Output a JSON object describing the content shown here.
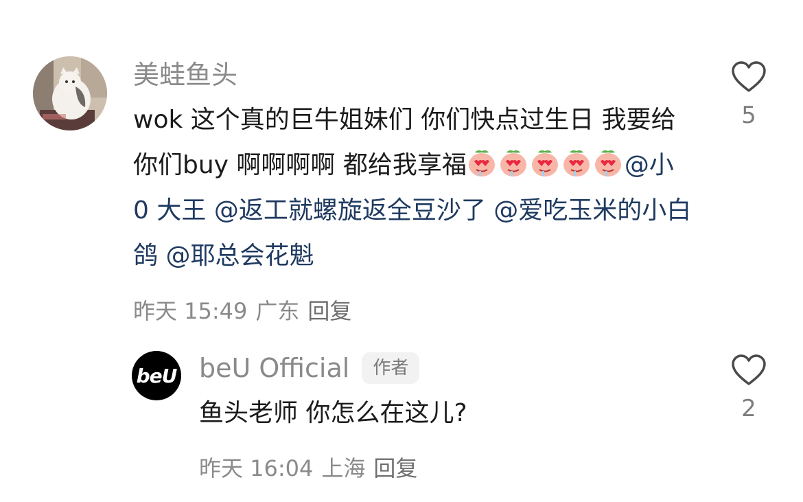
{
  "comments": [
    {
      "username": "美蛙鱼头",
      "text_parts": {
        "p1": "wok 这个真的巨牛姐妹们 你们快点过生日 我要给你们buy 啊啊啊啊 都给我享福",
        "mention1": "@小 0 大王",
        "mention2": "@返工就螺旋返全豆沙了",
        "mention3": "@爱吃玉米的小白鸽",
        "mention4": "@耶总会花魁"
      },
      "emoji_name": "heart-eyes-peach-emoji",
      "emoji_count": 5,
      "date": "昨天 15:49",
      "location": "广东",
      "reply_label": "回复",
      "like_count": "5"
    },
    {
      "username": "beU Official",
      "avatar_text": "beU",
      "author_badge": "作者",
      "text": "鱼头老师 你怎么在这儿?",
      "date": "昨天 16:04",
      "location": "上海",
      "reply_label": "回复",
      "like_count": "2"
    }
  ],
  "colors": {
    "mention": "#1f3a60",
    "meta": "#8a8a8a",
    "text": "#1b1b1b"
  },
  "icons": {
    "like": "heart-outline-icon"
  }
}
